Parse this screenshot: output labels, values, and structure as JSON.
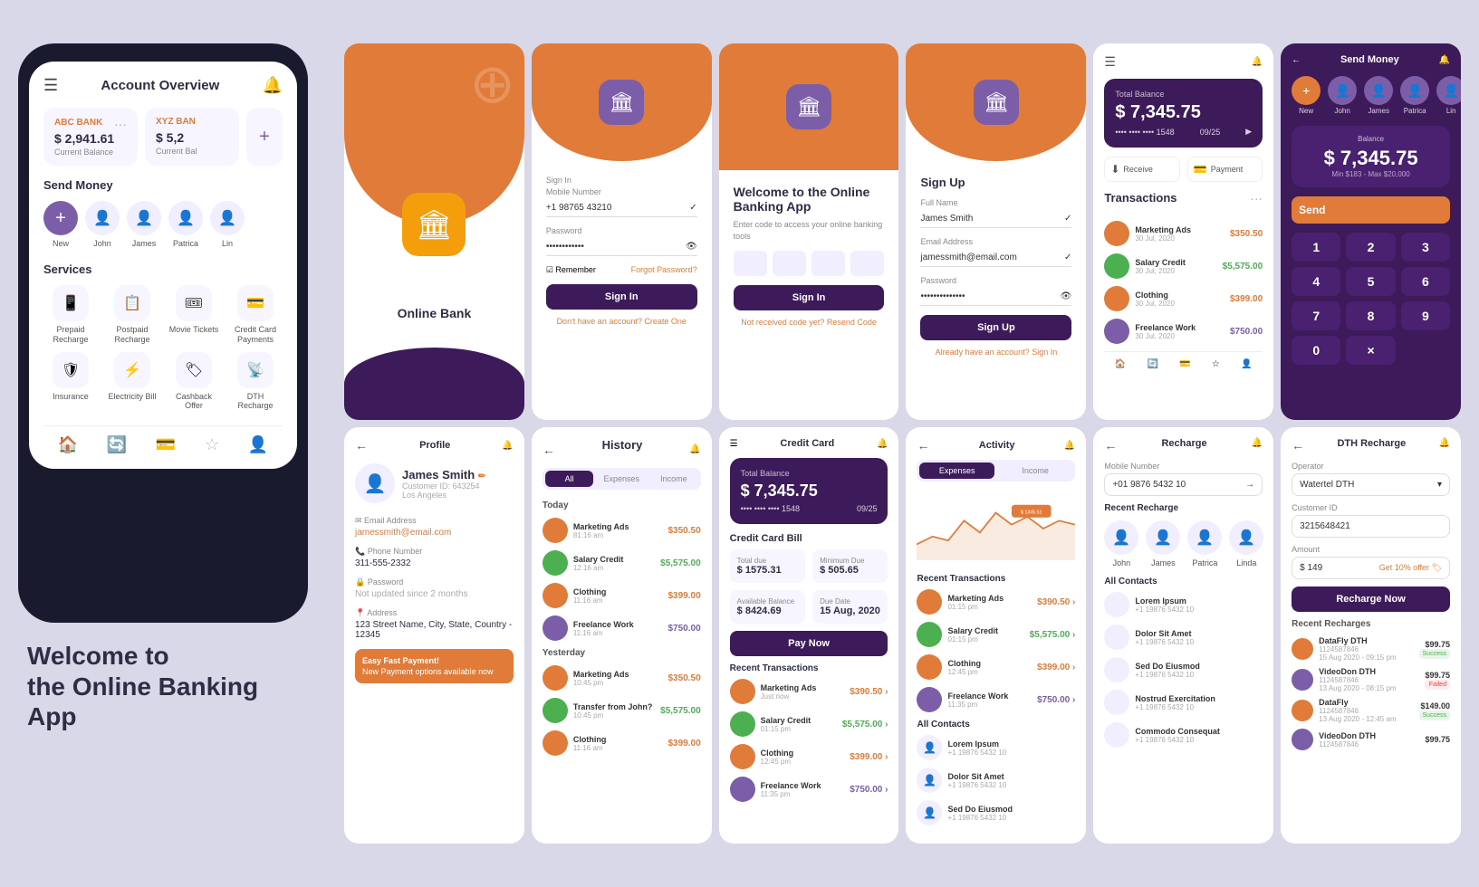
{
  "app": {
    "name": "Online Banking App",
    "tagline": "Welcome to the Online Banking App"
  },
  "welcome": {
    "line1": "Welcome to",
    "line2": "the Online Banking",
    "line3": "App"
  },
  "phone": {
    "header": {
      "title": "Account Overview",
      "bell": "🔔"
    },
    "cards": [
      {
        "bank": "ABC BANK",
        "balance": "$ 2,941.61",
        "label": "Current Balance"
      },
      {
        "bank": "XYZ BAN",
        "balance": "$ 5,2",
        "label": "Current Bal"
      }
    ],
    "send_money": {
      "title": "Send Money",
      "contacts": [
        {
          "name": "New",
          "type": "new"
        },
        {
          "name": "John",
          "type": "person"
        },
        {
          "name": "James",
          "type": "person"
        },
        {
          "name": "Patrica",
          "type": "person"
        },
        {
          "name": "Lin",
          "type": "person"
        }
      ]
    },
    "services": {
      "title": "Services",
      "items": [
        {
          "name": "Prepaid Recharge",
          "icon": "📱"
        },
        {
          "name": "Postpaid Recharge",
          "icon": "📋"
        },
        {
          "name": "Movie Tickets",
          "icon": "🎟"
        },
        {
          "name": "Credit Card Payments",
          "icon": "💳"
        },
        {
          "name": "Insurance",
          "icon": "🛡"
        },
        {
          "name": "Electricity Bill",
          "icon": "⚡"
        },
        {
          "name": "Cashback Offer",
          "icon": "🏷"
        },
        {
          "name": "DTH Recharge",
          "icon": "📡"
        }
      ]
    }
  },
  "screens": {
    "splash": {
      "app_name": "Online Bank"
    },
    "signin": {
      "title": "Sign In",
      "mobile_label": "Mobile Number",
      "mobile_value": "+1   98765 43210",
      "password_label": "Password",
      "password_value": "••••••••••••",
      "remember": "Remember",
      "forgot": "Forgot Password?",
      "btn": "Sign In",
      "no_account": "Don't have an account?",
      "create": "Create One"
    },
    "welcome_screen": {
      "heading": "Welcome to the Online Banking App",
      "sub": "Enter code to access your online banking tools",
      "btn": "Sign In",
      "not_received": "Not received code yet?",
      "resend": "Resend Code"
    },
    "signup": {
      "title": "Sign Up",
      "name_label": "Full Name",
      "name_value": "James Smith",
      "email_label": "Email Address",
      "email_value": "jamessmith@email.com",
      "password_label": "Password",
      "password_value": "••••••••••••••",
      "btn": "Sign Up",
      "have_account": "Already have an account?",
      "signin": "Sign In"
    },
    "dashboard": {
      "title": "Total Balance",
      "balance": "$ 7,345.75",
      "card_stars": "•••• •••• •••• 1548",
      "card_date": "09/25",
      "receive_btn": "Receive",
      "payment_btn": "Payment",
      "transactions_title": "Transactions",
      "transactions": [
        {
          "name": "Marketing Ads",
          "date": "30 Jul, 2020",
          "amount": "$350.50"
        },
        {
          "name": "Salary Credit",
          "date": "30 Jul, 2020",
          "amount": "$5,575.00"
        },
        {
          "name": "Clothing",
          "date": "30 Jul, 2020",
          "amount": "$399.00"
        },
        {
          "name": "Freelance Work",
          "date": "30 Jul, 2020",
          "amount": "$750.00"
        }
      ]
    },
    "send_money": {
      "title": "Send Money",
      "contacts": [
        "New",
        "John",
        "James",
        "Patrica",
        "Lin"
      ],
      "balance_label": "$ 7,345.75",
      "balance_sub": "Min $183 - Max $20,000",
      "send_btn": "Send",
      "numpad": [
        "1",
        "2",
        "3",
        "4",
        "5",
        "6",
        "7",
        "8",
        "9",
        "0",
        "×"
      ]
    },
    "profile": {
      "title": "Profile",
      "name": "James Smith",
      "customer_id": "Customer ID: 643254",
      "city": "Los Angeles",
      "fields": [
        {
          "label": "Email Address",
          "icon": "✉",
          "value": "jamessmith@email.com"
        },
        {
          "label": "Phone Number",
          "icon": "📞",
          "value": "311-555-2332"
        },
        {
          "label": "Password",
          "icon": "🔒",
          "value": "Not updated since 2 months"
        },
        {
          "label": "Address",
          "icon": "📍",
          "value": "123 Street Name, City, State, Country - 12345"
        }
      ],
      "notice": "Easy Fast Payment! New Payment options available now"
    },
    "history": {
      "title": "History",
      "tabs": [
        "All",
        "Expenses",
        "Income"
      ],
      "today": {
        "label": "Today",
        "items": [
          {
            "name": "Marketing Ads",
            "time": "81:16 am",
            "amount": "$350.50"
          },
          {
            "name": "Salary Credit",
            "time": "12:16 am",
            "amount": "$5,575.00"
          },
          {
            "name": "Clothing",
            "time": "11:16 am",
            "amount": "$399.00"
          },
          {
            "name": "Freelance Work",
            "time": "11:16 am",
            "amount": "$750.00"
          }
        ]
      },
      "yesterday": {
        "label": "Yesterday",
        "items": [
          {
            "name": "Marketing Ads",
            "time": "10:45 pm",
            "amount": "$350.50"
          },
          {
            "name": "Transfer from John?",
            "time": "10:45 pm",
            "amount": "$5,575.00"
          },
          {
            "name": "Clothing",
            "time": "11:16 am",
            "amount": "$399.00"
          }
        ]
      }
    },
    "credit_card": {
      "title": "Credit Card",
      "balance": "$ 7,345.75",
      "card_stars": "•••• •••• •••• 1548",
      "card_date": "09/25",
      "bill_title": "Credit Card Bill",
      "bill_items": [
        {
          "label": "Total due",
          "value": "$ 1575.31"
        },
        {
          "label": "Minimum Due",
          "value": "$ 505.65"
        },
        {
          "label": "Available Balance",
          "value": "$ 8424.69"
        },
        {
          "label": "Due Date",
          "value": "15 Aug, 2020"
        }
      ],
      "pay_btn": "Pay Now",
      "transactions_title": "Recent Transactions",
      "transactions": [
        {
          "name": "Marketing Ads",
          "time": "Just now",
          "amount": "$390.50"
        },
        {
          "name": "Salary Credit",
          "time": "01:15 pm",
          "amount": "$5,575.00"
        },
        {
          "name": "Clothing",
          "time": "12:45 pm",
          "amount": "$399.00"
        },
        {
          "name": "Freelance Work",
          "time": "11:35 pm",
          "amount": "$750.00"
        }
      ]
    },
    "activity": {
      "title": "Activity",
      "tabs": [
        "Expenses",
        "Income"
      ],
      "transactions_title": "Recent Transactions",
      "balance_badge": "$ 1345.51",
      "transactions": [
        {
          "name": "Marketing Ads",
          "time": "01:15 pm",
          "amount": "$390.50"
        },
        {
          "name": "Salary Credit",
          "time": "01:15 pm",
          "amount": "$5,575.00"
        },
        {
          "name": "Clothing",
          "time": "12:45 pm",
          "amount": "$399.00"
        },
        {
          "name": "Freelance Work",
          "time": "11:35 pm",
          "amount": "$750.00"
        },
        {
          "name": "Commodo Consequat",
          "time": "",
          "amount": ""
        }
      ],
      "contacts": [
        {
          "name": "Lorem Ipsum",
          "phone": "+1 19876 5432 10"
        },
        {
          "name": "Dolor Sit Amet",
          "phone": "+1 19876 5432 10"
        },
        {
          "name": "Sed Do Eiusmod",
          "phone": "+1 19876 5432 10"
        },
        {
          "name": "Nostrud Exercitation",
          "phone": "+1 19876 5432 10"
        },
        {
          "name": "Commodo Consequat",
          "phone": "+1 19876 5432 10"
        }
      ]
    },
    "recharge": {
      "title": "Recharge",
      "mobile_label": "Mobile Number",
      "mobile_value": "+01   9876 5432 10",
      "recent_title": "Recent Recharge",
      "contacts": [
        "John",
        "James",
        "Patrica",
        "Linda"
      ],
      "all_contacts_title": "All Contacts",
      "contacts_list": [
        {
          "name": "Lorem Ipsum",
          "phone": "+1 19876 5432 10"
        },
        {
          "name": "Dolor Sit Amet",
          "phone": "+1 19876 5432 10"
        },
        {
          "name": "Sed Do Eiusmod",
          "phone": "+1 19876 5432 10"
        },
        {
          "name": "Nostrud Exercitation",
          "phone": "+1 19876 5432 10"
        },
        {
          "name": "Commodo Consequat",
          "phone": "+1 19876 5432 10"
        }
      ]
    },
    "dth": {
      "title": "DTH Recharge",
      "operator_label": "Operator",
      "operator_value": "Watertel DTH",
      "customer_id_label": "Customer ID",
      "customer_id_value": "3215648421",
      "amount_label": "Amount",
      "amount_value": "$ 149",
      "recharge_btn": "Recharge Now",
      "recent_title": "Recent Recharges",
      "items": [
        {
          "name": "DataFly DTH",
          "id": "1124587846",
          "date": "15 Aug 2020 - 09:15 pm",
          "amount": "$99.75",
          "status": "Success"
        },
        {
          "name": "VideoDon DTH",
          "id": "1124587846",
          "date": "13 Aug 2020 - 08:15 pm",
          "amount": "$99.75",
          "status": "Failed"
        },
        {
          "name": "DataFly",
          "id": "1124587846",
          "date": "13 Aug 2020 - 12:45 am",
          "amount": "$149.00",
          "status": "Success"
        },
        {
          "name": "VideoDon DTH",
          "id": "1124587846",
          "date": "",
          "amount": "$99.75",
          "status": ""
        }
      ]
    }
  },
  "colors": {
    "orange": "#e07b39",
    "purple_dark": "#3d1a5a",
    "purple_mid": "#7b5ea7",
    "bg_light": "#d8d8e8",
    "white": "#ffffff"
  }
}
